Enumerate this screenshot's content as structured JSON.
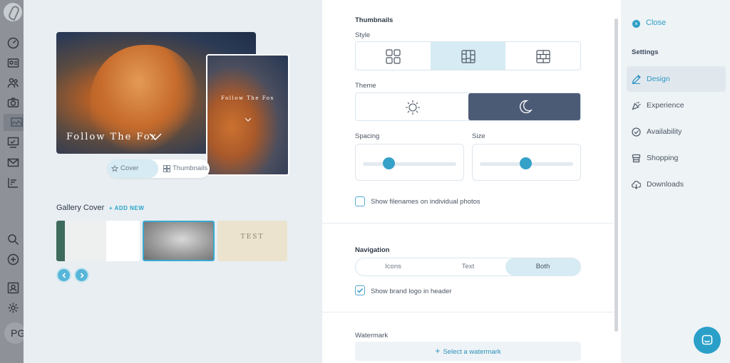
{
  "sidebar": {
    "avatar_initials": "PG",
    "icons": [
      "dashboard-icon",
      "contacts-icon",
      "people-icon",
      "camera-icon",
      "gallery-icon",
      "tasks-icon",
      "mail-icon",
      "reports-icon",
      "search-icon",
      "add-icon",
      "portfolio-icon",
      "settings-icon"
    ]
  },
  "preview": {
    "cover_title": "Follow The Fox",
    "thumb_title": "Follow The Fox",
    "toggle": {
      "cover_label": "Cover",
      "thumbnails_label": "Thumbnails",
      "selected": "Cover"
    },
    "gallery_cover": {
      "heading": "Gallery Cover",
      "add_new": "+ ADD NEW",
      "test_label": "TEST"
    }
  },
  "settings": {
    "thumbnails": {
      "title": "Thumbnails",
      "style_label": "Style",
      "style_options": [
        "grid-icon",
        "columns-icon",
        "masonry-icon"
      ],
      "style_selected": 1,
      "theme_label": "Theme",
      "theme_options": [
        "sun-icon",
        "moon-icon"
      ],
      "theme_selected": "dark",
      "spacing_label": "Spacing",
      "spacing_value": 0.28,
      "size_label": "Size",
      "size_value": 0.5,
      "show_filenames_label": "Show filenames on individual photos",
      "show_filenames_checked": false
    },
    "navigation": {
      "title": "Navigation",
      "options": [
        "Icons",
        "Text",
        "Both"
      ],
      "selected": "Both",
      "show_logo_label": "Show brand logo in header",
      "show_logo_checked": true
    },
    "watermark": {
      "label": "Watermark",
      "button": "Select a watermark"
    }
  },
  "rightnav": {
    "close_label": "Close",
    "heading": "Settings",
    "items": [
      {
        "label": "Design",
        "icon": "pen-icon",
        "active": true
      },
      {
        "label": "Experience",
        "icon": "party-icon",
        "active": false
      },
      {
        "label": "Availability",
        "icon": "check-circle-icon",
        "active": false
      },
      {
        "label": "Shopping",
        "icon": "store-icon",
        "active": false
      },
      {
        "label": "Downloads",
        "icon": "cloud-download-icon",
        "active": false
      }
    ]
  },
  "colors": {
    "accent": "#2ba3c8",
    "selected_bg": "#d6ebf3",
    "dark_theme": "#4c5b75"
  }
}
